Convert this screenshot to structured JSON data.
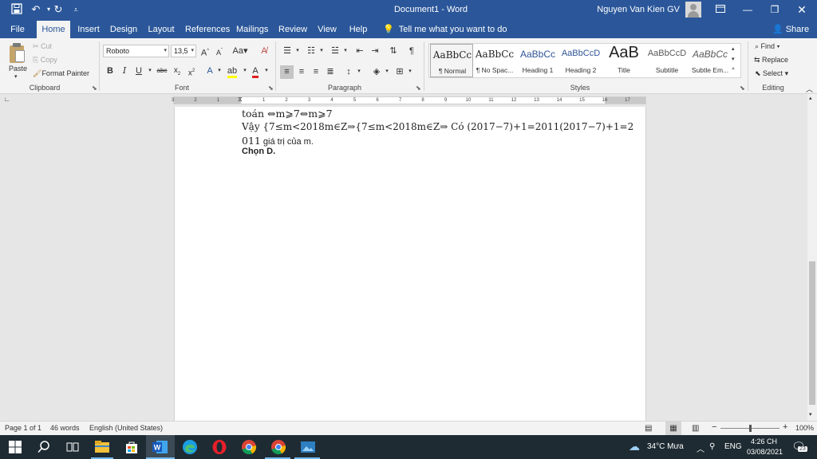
{
  "titlebar": {
    "doc_title": "Document1 - Word",
    "user_name": "Nguyen Van Kien GV"
  },
  "tabs": [
    "File",
    "Home",
    "Insert",
    "Design",
    "Layout",
    "References",
    "Mailings",
    "Review",
    "View",
    "Help"
  ],
  "tell_me": "Tell me what you want to do",
  "share": "Share",
  "clipboard": {
    "paste": "Paste",
    "cut": "Cut",
    "copy": "Copy",
    "format_painter": "Format Painter",
    "label": "Clipboard"
  },
  "font": {
    "name": "Roboto",
    "size": "13,5",
    "label": "Font"
  },
  "paragraph": {
    "label": "Paragraph"
  },
  "styles": {
    "label": "Styles",
    "items": [
      {
        "sample": "AaBbCc",
        "name": "¶ Normal"
      },
      {
        "sample": "AaBbCc",
        "name": "¶ No Spac..."
      },
      {
        "sample": "AaBbCc",
        "name": "Heading 1"
      },
      {
        "sample": "AaBbCcD",
        "name": "Heading 2"
      },
      {
        "sample": "AaB",
        "name": "Title"
      },
      {
        "sample": "AaBbCcD",
        "name": "Subtitle"
      },
      {
        "sample": "AaBbCc",
        "name": "Subtle Em..."
      }
    ]
  },
  "editing": {
    "label": "Editing",
    "find": "Find",
    "replace": "Replace",
    "select": "Select"
  },
  "document": {
    "line1": "toán ⇔m⩾7⇔m⩾7",
    "line2": "Vậy {7≤m<2018m∈Z⇒{7≤m<2018m∈Z⇒ Có (2017−7)+1=2011(2017−7)+1=2",
    "line3a": "011",
    "line3b": " giá trị của m.",
    "line4": "Chọn D."
  },
  "status": {
    "page": "Page 1 of 1",
    "words": "46 words",
    "language": "English (United States)",
    "zoom": "100%",
    "zoom_value": 100
  },
  "taskbar": {
    "weather": "34°C  Mưa",
    "lang": "ENG",
    "time": "4:26 CH",
    "date": "03/08/2021",
    "notif_count": "23"
  },
  "colors": {
    "accent": "#2b579a",
    "taskbar": "#1f2b33"
  }
}
